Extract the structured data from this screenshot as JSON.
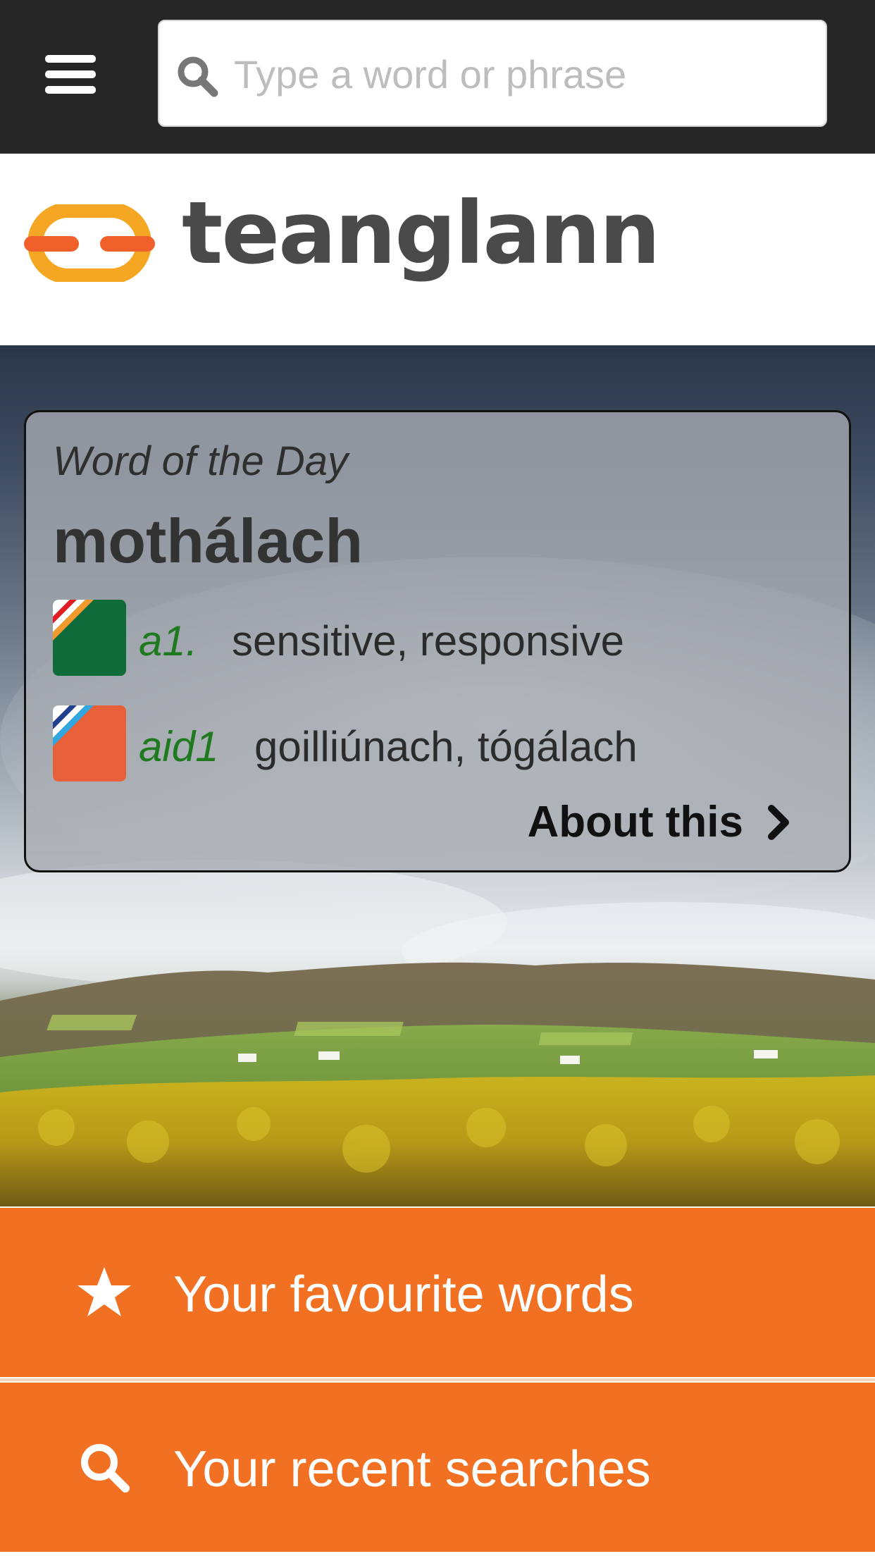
{
  "header": {
    "menu_icon": "hamburger-menu-icon",
    "search": {
      "placeholder": "Type a word or phrase",
      "value": "",
      "icon": "search-icon"
    }
  },
  "brand": {
    "name": "teanglann",
    "logo_icon": "chain-link-logo",
    "colors": {
      "link_yellow": "#f5a623",
      "link_orange": "#f0602a",
      "text": "#4a4a4a"
    }
  },
  "word_of_the_day": {
    "label": "Word of the Day",
    "word": "mothálach",
    "definitions": [
      {
        "pos": "a1.",
        "text": "sensitive, responsive",
        "flag_icon": "english-dictionary-flag-icon"
      },
      {
        "pos": "aid1",
        "text": "goilliúnach, tógálach",
        "flag_icon": "irish-dictionary-flag-icon"
      }
    ],
    "about_label": "About this",
    "about_icon": "chevron-right-icon"
  },
  "actions": [
    {
      "label": "Your favourite words",
      "icon": "star-icon"
    },
    {
      "label": "Your recent searches",
      "icon": "search-icon"
    }
  ],
  "colors": {
    "topbar": "#262626",
    "accent_orange": "#f27022",
    "pos_green": "#1f7a1f"
  }
}
